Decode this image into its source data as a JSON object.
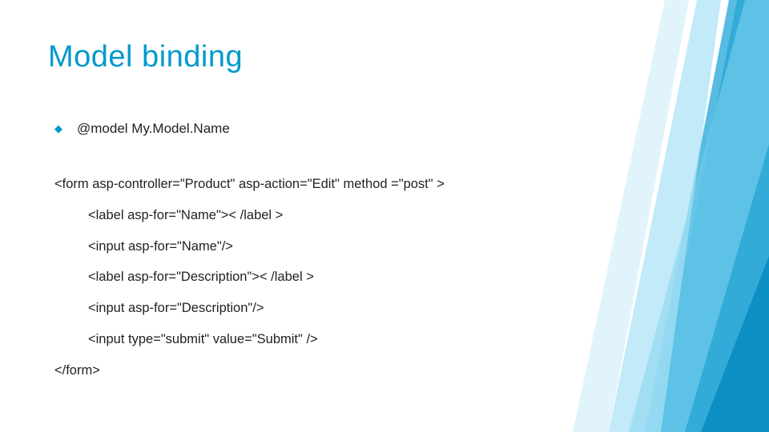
{
  "title": "Model binding",
  "bullet": "@model My.Model.Name",
  "code": {
    "line1": "<form asp-controller=\"Product\" asp-action=\"Edit\" method =\"post\" >",
    "line2": "<label asp-for=\"Name\">< /label >",
    "line3": "<input asp-for=\"Name\"/>",
    "line4": "<label asp-for=\"Description\">< /label >",
    "line5": "<input asp-for=\"Description\"/>",
    "line6": "<input type=\"submit\" value=\"Submit\" />",
    "line7": "</form>"
  }
}
